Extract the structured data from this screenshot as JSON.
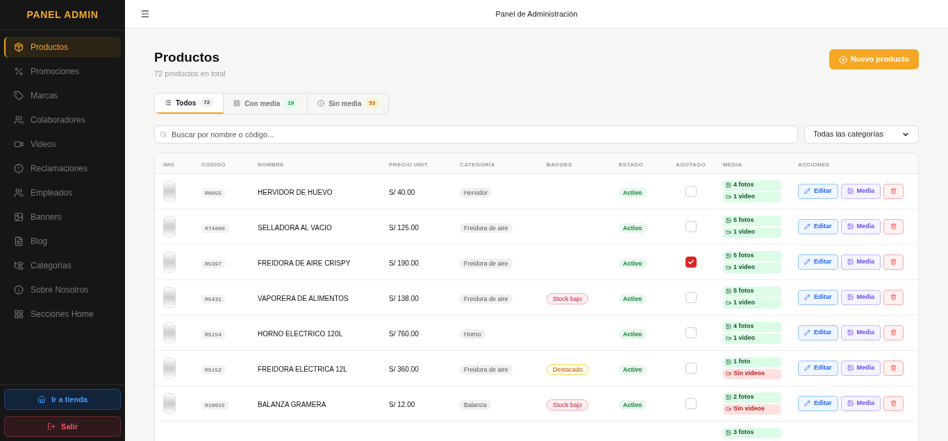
{
  "sidebar": {
    "brand": "PANEL ADMIN",
    "items": [
      {
        "label": "Productos",
        "selected": true
      },
      {
        "label": "Promociones",
        "selected": false
      },
      {
        "label": "Marcas",
        "selected": false
      },
      {
        "label": "Colaboradores",
        "selected": false
      },
      {
        "label": "Videos",
        "selected": false
      },
      {
        "label": "Reclamaciones",
        "selected": false
      },
      {
        "label": "Empleados",
        "selected": false
      },
      {
        "label": "Banners",
        "selected": false
      },
      {
        "label": "Blog",
        "selected": false
      },
      {
        "label": "Categorías",
        "selected": false
      },
      {
        "label": "Sobre Nosotros",
        "selected": false
      },
      {
        "label": "Secciones Home",
        "selected": false
      }
    ],
    "store_button": "Ir a tienda",
    "logout_button": "Salir"
  },
  "header": {
    "title": "Panel de Administración"
  },
  "page": {
    "title": "Productos",
    "subtitle": "72 productos en total",
    "new_button": "Nuevo producto"
  },
  "tabs": [
    {
      "label": "Todos",
      "count": "72",
      "selected": true
    },
    {
      "label": "Con media",
      "count": "19",
      "selected": false
    },
    {
      "label": "Sin media",
      "count": "53",
      "selected": false
    }
  ],
  "search": {
    "placeholder": "Buscar por nombre o código..."
  },
  "category_filter": {
    "value": "Todas las categorías"
  },
  "table": {
    "columns": [
      "IMG",
      "CÓDIGO",
      "NOMBRE",
      "PRECIO UNIT.",
      "CATEGORÍA",
      "BADGES",
      "ESTADO",
      "AGOTADO",
      "MEDIA",
      "ACCIONES"
    ],
    "rows": [
      {
        "code": "R0055",
        "name": "HERVIDOR DE HUEVO",
        "price": "S/ 40.00",
        "category": "Hervidor",
        "badges": [],
        "status": "Activo",
        "sold_out": false,
        "media": [
          {
            "kind": "photo",
            "ok": true,
            "label": "4 fotos"
          },
          {
            "kind": "video",
            "ok": true,
            "label": "1 video"
          }
        ],
        "actions": [
          "Editar",
          "Media"
        ]
      },
      {
        "code": "R74000",
        "name": "SELLADORA AL VACIO",
        "price": "S/ 125.00",
        "category": "Freidora de aire",
        "badges": [],
        "status": "Activo",
        "sold_out": false,
        "media": [
          {
            "kind": "photo",
            "ok": true,
            "label": "5 fotos"
          },
          {
            "kind": "video",
            "ok": true,
            "label": "1 video"
          }
        ],
        "actions": [
          "Editar",
          "Media"
        ]
      },
      {
        "code": "R5397",
        "name": "FREIDORA DE AIRE CRISPY",
        "price": "S/ 190.00",
        "category": "Freidora de aire",
        "badges": [],
        "status": "Activo",
        "sold_out": true,
        "media": [
          {
            "kind": "photo",
            "ok": true,
            "label": "5 fotos"
          },
          {
            "kind": "video",
            "ok": true,
            "label": "1 video"
          }
        ],
        "actions": [
          "Editar",
          "Media"
        ]
      },
      {
        "code": "R5431",
        "name": "VAPORERA DE ALIMENTOS",
        "price": "S/ 138.00",
        "category": "Freidora de aire",
        "badges": [
          {
            "kind": "stock",
            "label": "Stock bajo"
          }
        ],
        "status": "Activo",
        "sold_out": false,
        "media": [
          {
            "kind": "photo",
            "ok": true,
            "label": "5 fotos"
          },
          {
            "kind": "video",
            "ok": true,
            "label": "1 video"
          }
        ],
        "actions": [
          "Editar",
          "Media"
        ]
      },
      {
        "code": "R5154",
        "name": "HORNO ELECTRICO 120L",
        "price": "S/ 760.00",
        "category": "Horno",
        "badges": [],
        "status": "Activo",
        "sold_out": false,
        "media": [
          {
            "kind": "photo",
            "ok": true,
            "label": "4 fotos"
          },
          {
            "kind": "video",
            "ok": true,
            "label": "1 video"
          }
        ],
        "actions": [
          "Editar",
          "Media"
        ]
      },
      {
        "code": "R5152",
        "name": "FREIDORA ELÉCTRICA 12L",
        "price": "S/ 360.00",
        "category": "Freidora de aire",
        "badges": [
          {
            "kind": "featured",
            "label": "Destacado"
          }
        ],
        "status": "Activo",
        "sold_out": false,
        "media": [
          {
            "kind": "photo",
            "ok": true,
            "label": "1 foto"
          },
          {
            "kind": "video",
            "ok": false,
            "label": "Sin videos"
          }
        ],
        "actions": [
          "Editar",
          "Media"
        ]
      },
      {
        "code": "R10015",
        "name": "BALANZA GRAMERA",
        "price": "S/ 12.00",
        "category": "Balanza",
        "badges": [
          {
            "kind": "stock",
            "label": "Stock bajo"
          }
        ],
        "status": "Activo",
        "sold_out": false,
        "media": [
          {
            "kind": "photo",
            "ok": true,
            "label": "2 fotos"
          },
          {
            "kind": "video",
            "ok": false,
            "label": "Sin videos"
          }
        ],
        "actions": [
          "Editar",
          "Media"
        ]
      },
      {
        "media": [
          {
            "kind": "photo",
            "ok": true,
            "label": "3 fotos"
          }
        ]
      }
    ]
  }
}
